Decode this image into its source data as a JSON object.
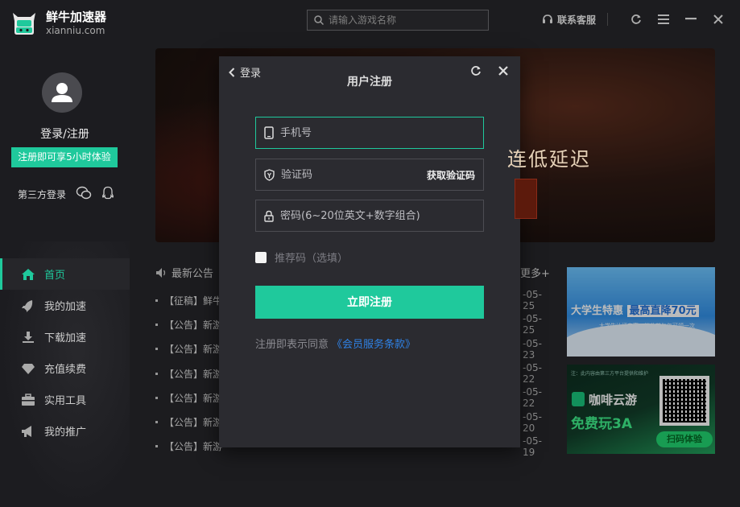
{
  "app": {
    "name": "鲜牛加速器",
    "url": "xianniu.com"
  },
  "sidebar": {
    "login_label": "登录/注册",
    "promo": "注册即可享5小时体验",
    "third_party_label": "第三方登录",
    "nav": [
      {
        "label": "首页",
        "icon": "home-icon",
        "active": true
      },
      {
        "label": "我的加速",
        "icon": "rocket-icon"
      },
      {
        "label": "下载加速",
        "icon": "download-icon"
      },
      {
        "label": "充值续费",
        "icon": "diamond-icon"
      },
      {
        "label": "实用工具",
        "icon": "toolbox-icon"
      },
      {
        "label": "我的推广",
        "icon": "megaphone-icon"
      }
    ]
  },
  "topbar": {
    "search_placeholder": "请输入游戏名称",
    "support": "联系客服"
  },
  "banner": {
    "text": "连低延迟"
  },
  "news": {
    "title": "最新公告",
    "more": "更多+",
    "items": [
      {
        "title": "【征稿】鲜牛",
        "date": "-05-25"
      },
      {
        "title": "【公告】新游",
        "date": "-05-25"
      },
      {
        "title": "【公告】新游",
        "date": "-05-23"
      },
      {
        "title": "【公告】新游",
        "date": "-05-22"
      },
      {
        "title": "【公告】新游",
        "date": "-05-22"
      },
      {
        "title": "【公告】新游",
        "date": "-05-20"
      },
      {
        "title": "【公告】新游",
        "date": "-05-19"
      }
    ]
  },
  "ads": {
    "ad1": {
      "text_a": "大学生特惠",
      "text_b": "最高直降70元",
      "sub": "大学生认证专享，毕业前每年可领一次"
    },
    "ad2": {
      "note": "注：此内容由第三方平台提供和维护",
      "title": "咖啡云游",
      "sub": "免费玩3A",
      "scan": "扫码体验"
    }
  },
  "dialog": {
    "back_label": "登录",
    "title": "用户注册",
    "phone_placeholder": "手机号",
    "code_placeholder": "验证码",
    "get_code": "获取验证码",
    "password_placeholder": "密码(6~20位英文+数字组合)",
    "referral": "推荐码（选填）",
    "submit": "立即注册",
    "terms_prefix": "注册即表示同意",
    "terms_link": "《会员服务条款》"
  }
}
